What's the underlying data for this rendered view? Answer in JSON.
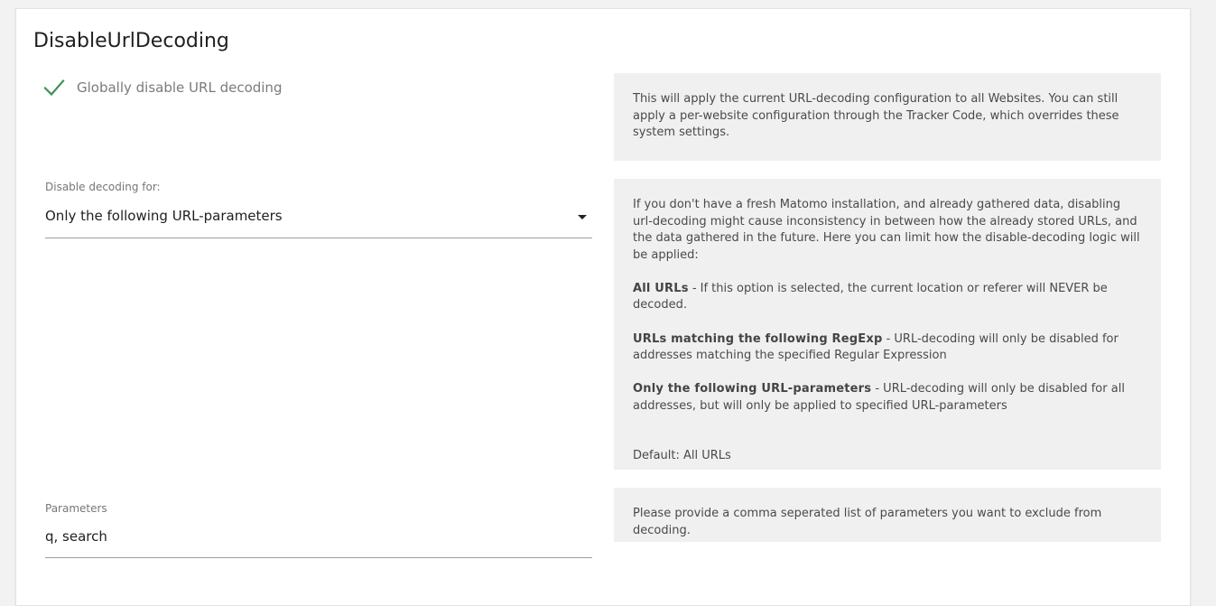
{
  "card": {
    "title": "DisableUrlDecoding"
  },
  "global_setting": {
    "checked": true,
    "label": "Globally disable URL decoding",
    "check_color": "#2f8a4a",
    "help": "This will apply the current URL-decoding configuration to all Websites. You can still apply a per-website configuration through the Tracker Code, which overrides these system settings."
  },
  "decoding_select": {
    "label": "Disable decoding for:",
    "selected": "Only the following URL-parameters",
    "help": {
      "intro": "If you don't have a fresh Matomo installation, and already gathered data, disabling url-decoding might cause inconsistency in between how the already stored URLs, and the data gathered in the future. Here you can limit how the disable-decoding logic will be applied:",
      "options": [
        {
          "name": "All URLs",
          "text": " - If this option is selected, the current location or referer will NEVER be decoded."
        },
        {
          "name": "URLs matching the following RegExp",
          "text": " - URL-decoding will only be disabled for addresses matching the specified Regular Expression"
        },
        {
          "name": "Only the following URL-parameters",
          "text": " - URL-decoding will only be disabled for all addresses, but will only be applied to specified URL-parameters"
        }
      ],
      "default": "Default: All URLs"
    }
  },
  "parameters": {
    "label": "Parameters",
    "value": "q, search",
    "help": "Please provide a comma seperated list of parameters you want to exclude from decoding."
  },
  "icons": {
    "checkbox": "checkmark-icon",
    "select": "caret-down-icon"
  }
}
